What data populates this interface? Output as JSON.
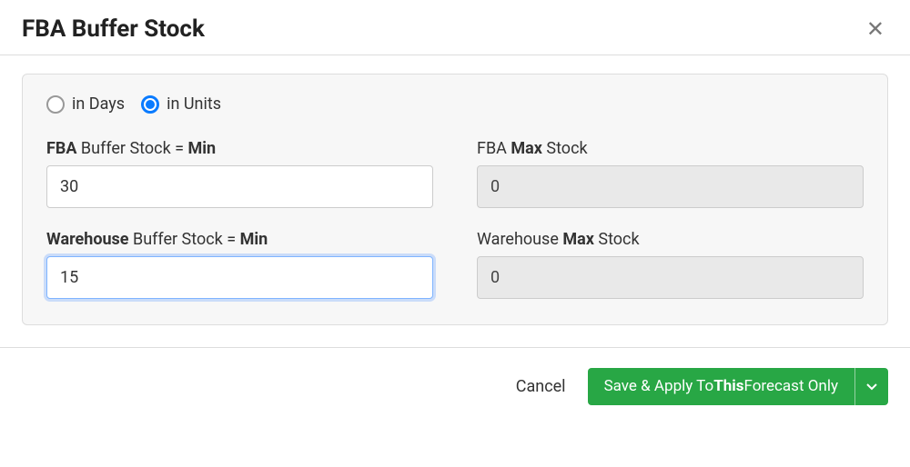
{
  "dialog": {
    "title": "FBA Buffer Stock"
  },
  "radios": {
    "days_label": "in Days",
    "units_label": "in Units",
    "selected": "units"
  },
  "fields": {
    "fba_min": {
      "label_strong1": "FBA",
      "label_mid": " Buffer Stock = ",
      "label_strong2": "Min",
      "value": "30"
    },
    "fba_max": {
      "label_prefix": "FBA ",
      "label_strong": "Max",
      "label_suffix": " Stock",
      "value": "0"
    },
    "wh_min": {
      "label_strong1": "Warehouse",
      "label_mid": " Buffer Stock = ",
      "label_strong2": "Min",
      "value": "15"
    },
    "wh_max": {
      "label_prefix": "Warehouse ",
      "label_strong": "Max",
      "label_suffix": " Stock",
      "value": "0"
    }
  },
  "footer": {
    "cancel": "Cancel",
    "save_prefix": "Save & Apply To ",
    "save_strong": "This",
    "save_suffix": " Forecast Only"
  }
}
